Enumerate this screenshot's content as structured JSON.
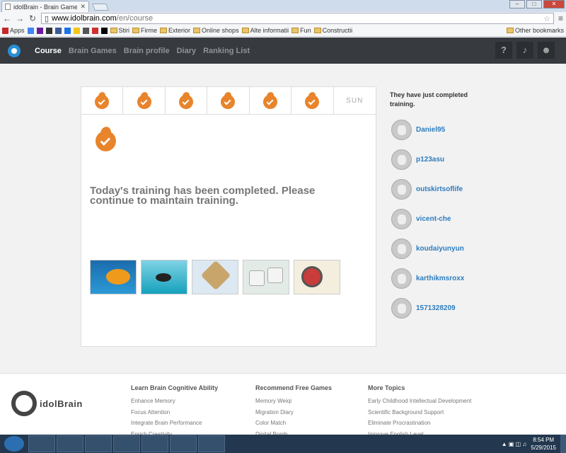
{
  "browser": {
    "tab_title": "idolBrain - Brain Games &",
    "url_host": "www.idolbrain.com",
    "url_path": "/en/course",
    "bookmarks": [
      {
        "label": "Apps",
        "icon": "apps-grid-icon"
      },
      {
        "label": "",
        "icon": "google-icon"
      },
      {
        "label": "",
        "icon": "yahoo-icon"
      },
      {
        "label": "",
        "icon": "tradeville-icon"
      },
      {
        "label": "",
        "icon": "facebook-icon"
      },
      {
        "label": "",
        "icon": "translate-icon"
      },
      {
        "label": "",
        "icon": "imdb-icon"
      },
      {
        "label": "",
        "icon": "rl-icon"
      },
      {
        "label": "",
        "icon": "bookmark-icon"
      },
      {
        "label": "",
        "icon": "bookmark-icon"
      },
      {
        "label": "Stiri",
        "icon": "folder-icon"
      },
      {
        "label": "Firme",
        "icon": "folder-icon"
      },
      {
        "label": "Exterior",
        "icon": "folder-icon"
      },
      {
        "label": "Online shops",
        "icon": "folder-icon"
      },
      {
        "label": "Alte informatii",
        "icon": "folder-icon"
      },
      {
        "label": "Fun",
        "icon": "folder-icon"
      },
      {
        "label": "Constructii",
        "icon": "folder-icon"
      }
    ],
    "other_bookmarks": "Other bookmarks"
  },
  "app": {
    "nav": [
      "Course",
      "Brain Games",
      "Brain profile",
      "Diary",
      "Ranking List"
    ],
    "active_nav": "Course",
    "help_label": "?",
    "accent_color": "#e8842b",
    "link_color": "#2d7cbf"
  },
  "main": {
    "week_last_day": "SUN",
    "completed_days": 6,
    "message": "Today's training has been completed. Please continue to maintain training.",
    "games": [
      "fish-game",
      "shadow-fish-game",
      "weiqi-board-game",
      "dice-game",
      "digital-bomb-game"
    ]
  },
  "sidebar": {
    "title": "They have just completed training.",
    "users": [
      "Daniel95",
      "p123asu",
      "outskirtsoflife",
      "vicent-che",
      "koudaiyunyun",
      "karthikmsroxx",
      "1571328209"
    ]
  },
  "footer": {
    "brand": "idolBrain",
    "columns": [
      {
        "heading": "Learn Brain Cognitive Ability",
        "links": [
          "Enhance Memory",
          "Focus Attention",
          "Integrate Brain Performance",
          "Enrich Creativity"
        ]
      },
      {
        "heading": "Recommend Free Games",
        "links": [
          "Memory Weiqi",
          "Migration Diary",
          "Color Match",
          "Digital Bomb"
        ]
      },
      {
        "heading": "More Topics",
        "links": [
          "Early Childhood Intellectual Development",
          "Scientific Background Support",
          "Eliminate Procrastination",
          "Improve English Level"
        ]
      }
    ]
  },
  "taskbar": {
    "time": "8:54 PM",
    "date": "5/29/2015"
  }
}
